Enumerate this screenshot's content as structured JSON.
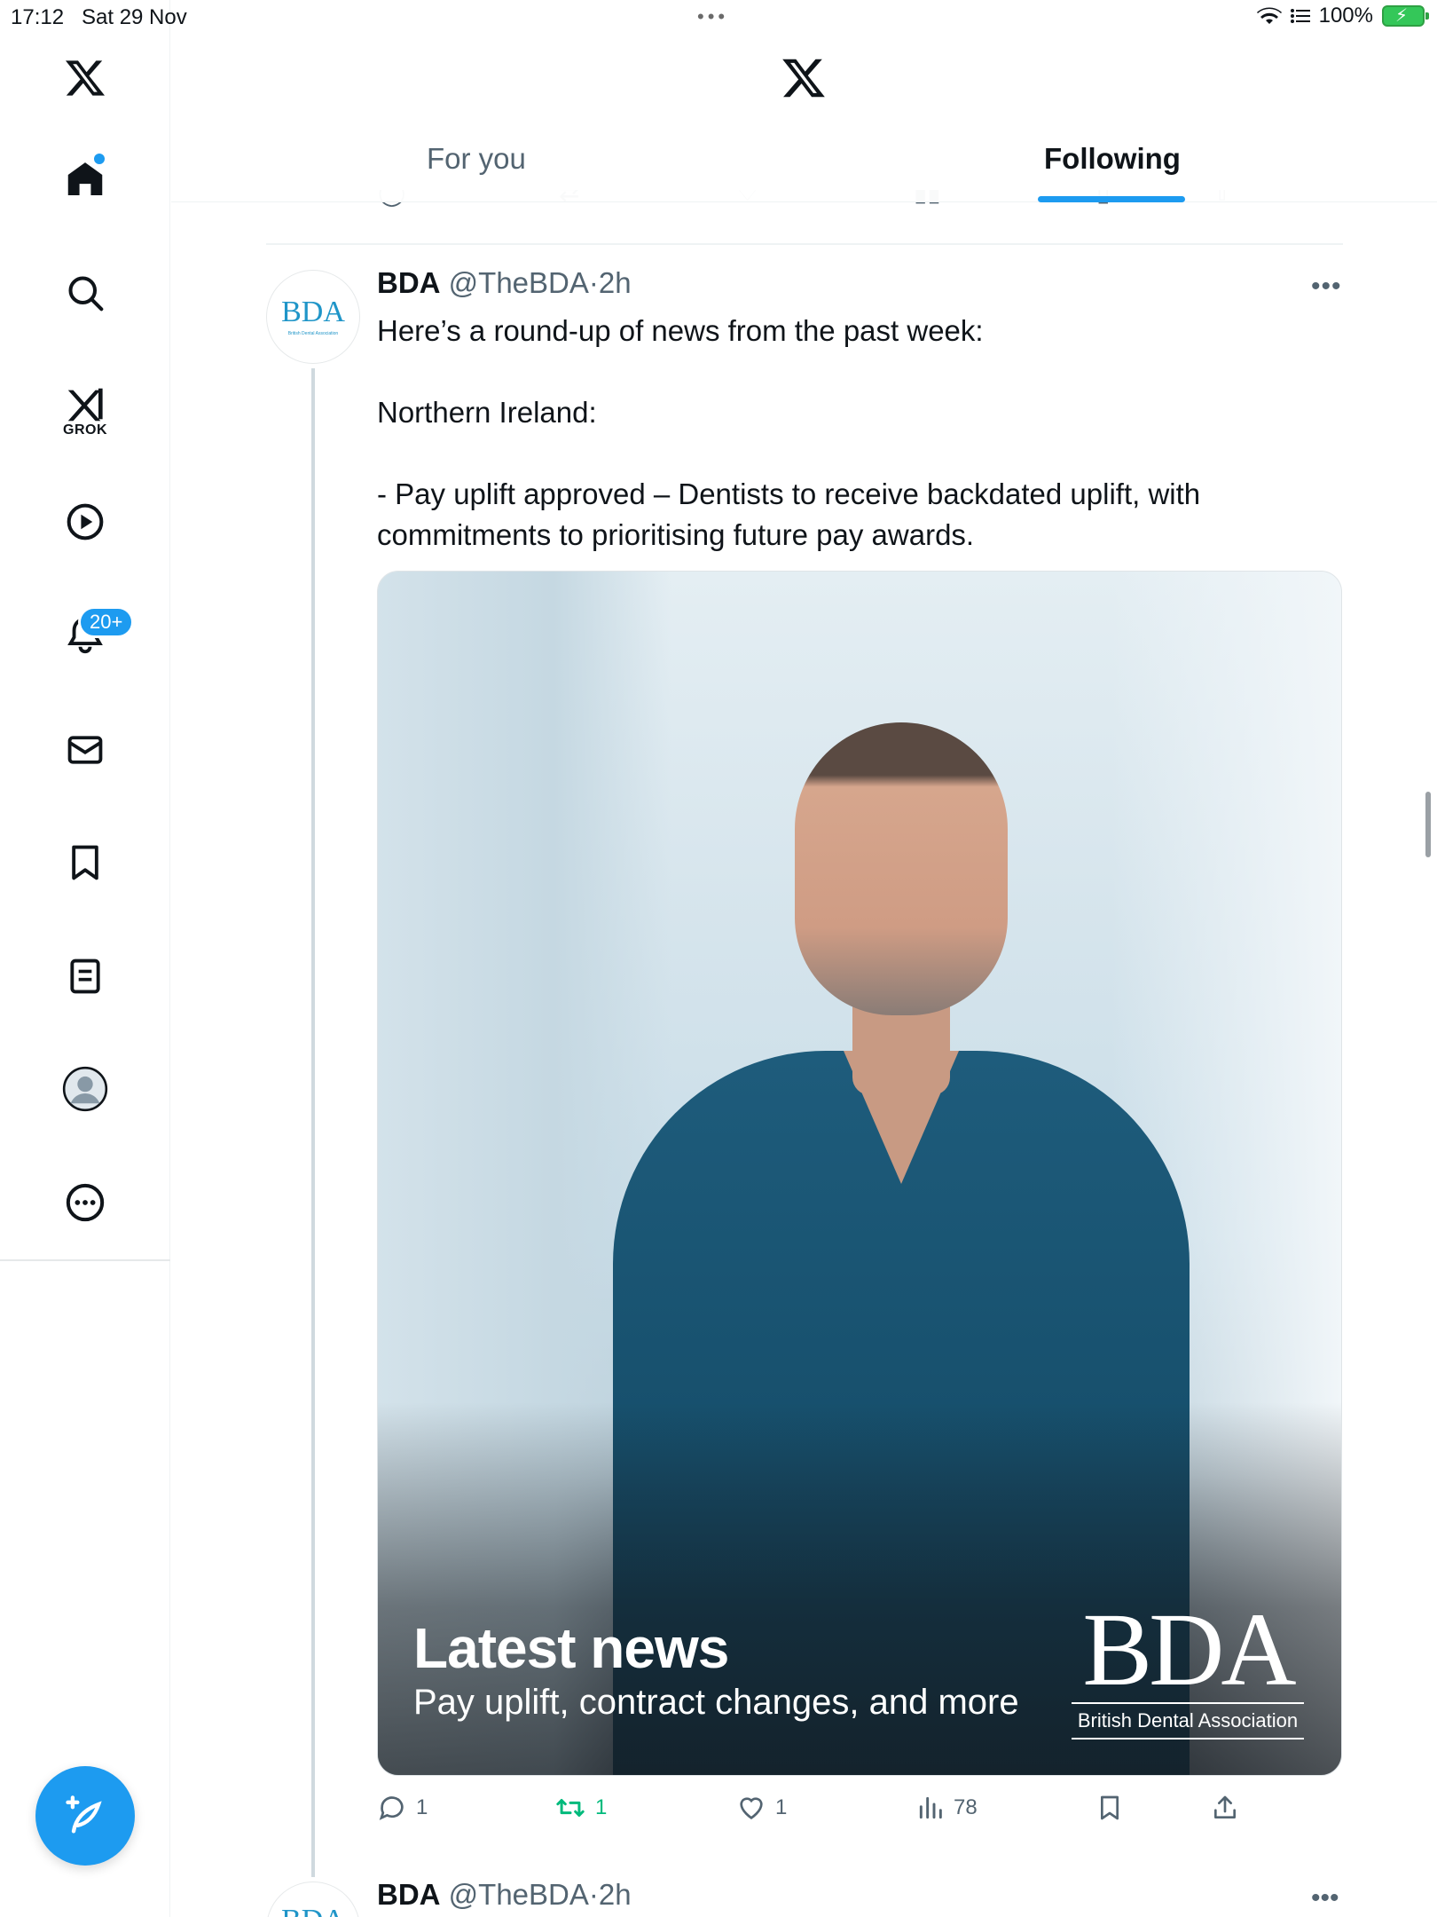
{
  "status_bar": {
    "time": "17:12",
    "date": "Sat 29 Nov",
    "battery": "100%"
  },
  "nav": {
    "items": [
      {
        "name": "home",
        "icon": "home-icon"
      },
      {
        "name": "search",
        "icon": "search-icon"
      },
      {
        "name": "grok",
        "icon": "grok-icon",
        "label": "GROK"
      },
      {
        "name": "video",
        "icon": "play-icon"
      },
      {
        "name": "notifications",
        "icon": "bell-icon",
        "badge": "20+"
      },
      {
        "name": "messages",
        "icon": "mail-icon"
      },
      {
        "name": "bookmarks",
        "icon": "bookmark-icon"
      },
      {
        "name": "lists",
        "icon": "list-icon"
      },
      {
        "name": "profile",
        "icon": "avatar-icon"
      },
      {
        "name": "more",
        "icon": "more-icon"
      }
    ],
    "compose_icon": "compose-icon"
  },
  "header": {
    "tabs": [
      {
        "label": "For you",
        "active": false
      },
      {
        "label": "Following",
        "active": true
      }
    ],
    "accent": "#1d9bf0"
  },
  "tweet": {
    "name": "BDA",
    "handle": "@TheBDA",
    "separator": "·",
    "time": "2h",
    "avatar_text": "BDA",
    "avatar_subtext": "British Dental Association",
    "text_lines": [
      "Here’s a round-up of news from the past week:",
      "",
      "Northern Ireland:",
      "",
      "- Pay uplift approved – Dentists to receive backdated uplift, with commitments to prioritising future pay awards."
    ],
    "media": {
      "title": "Latest news",
      "subtitle": "Pay uplift, contract changes, and more",
      "logo_big": "BDA",
      "logo_small": "British Dental Association"
    },
    "stats": {
      "replies": "1",
      "reposts": "1",
      "likes": "1",
      "views": "78"
    },
    "repost_color": "#00ba7c"
  },
  "next_tweet": {
    "name": "BDA",
    "handle": "@TheBDA",
    "separator": "·",
    "time": "2h",
    "avatar_text": "BDA"
  }
}
